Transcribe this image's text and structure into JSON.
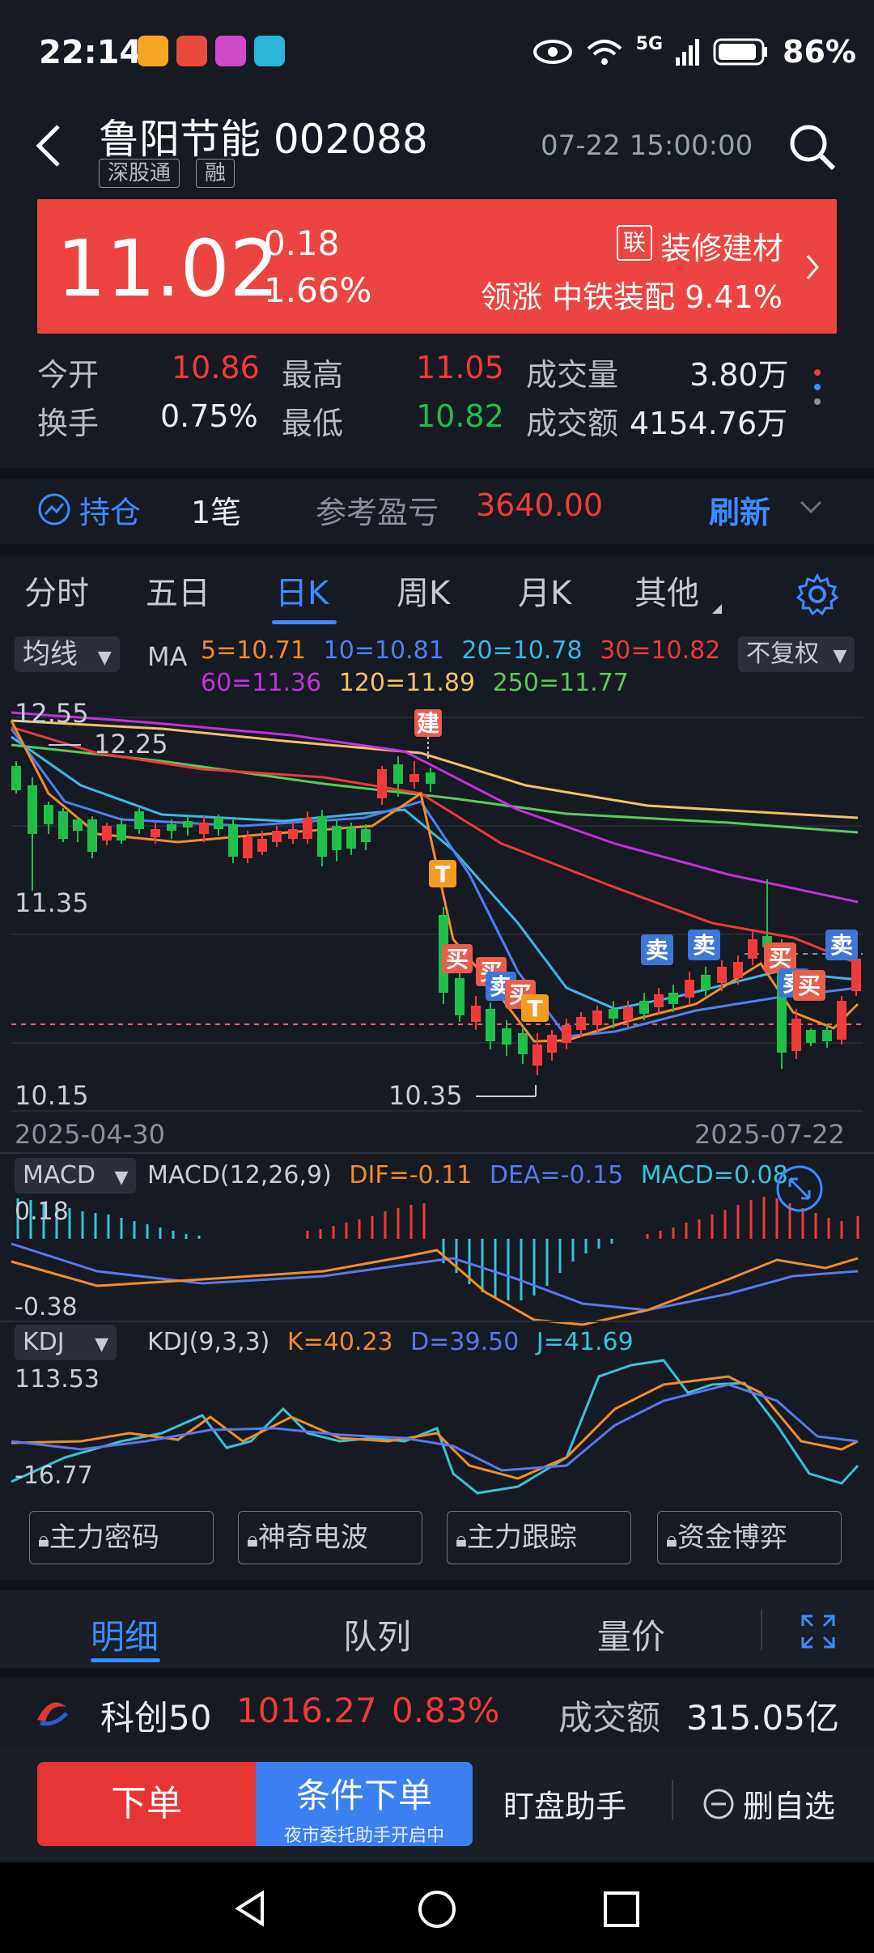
{
  "status": {
    "time": "22:14",
    "battery": "86%",
    "net": "5G"
  },
  "header": {
    "name": "鲁阳节能",
    "code": "002088",
    "tags": [
      "深股通",
      "融"
    ],
    "timestamp": "07-22 15:00:00"
  },
  "quote": {
    "price": "11.02",
    "change": "0.18",
    "pct": "1.66%",
    "sector_tag": "联",
    "sector": "装修建材",
    "leader": "领涨 中铁装配 9.41%"
  },
  "stats": {
    "open_label": "今开",
    "open": "10.86",
    "high_label": "最高",
    "high": "11.05",
    "vol_label": "成交量",
    "vol": "3.80万",
    "turn_label": "换手",
    "turn": "0.75%",
    "low_label": "最低",
    "low": "10.82",
    "amt_label": "成交额",
    "amt": "4154.76万"
  },
  "holding": {
    "label": "持仓",
    "count": "1笔",
    "pnl_label": "参考盈亏",
    "pnl": "3640.00",
    "refresh": "刷新"
  },
  "tabs": [
    "分时",
    "五日",
    "日K",
    "周K",
    "月K",
    "其他"
  ],
  "ma": {
    "select": "均线",
    "label": "MA",
    "ma5": "5=10.71",
    "ma10": "10=10.81",
    "ma20": "20=10.78",
    "ma30": "30=10.82",
    "ma60": "60=11.36",
    "ma120": "120=11.89",
    "ma250": "250=11.77",
    "adjust": "不复权"
  },
  "price_axis": {
    "top": "12.55",
    "mark": "12.25",
    "mid": "11.35",
    "bottom": "10.15",
    "low_mark": "10.35"
  },
  "dates": {
    "start": "2025-04-30",
    "end": "2025-07-22"
  },
  "signals": [
    "建",
    "T",
    "买",
    "买",
    "卖",
    "买",
    "T",
    "卖",
    "卖",
    "买",
    "卖",
    "买",
    "卖"
  ],
  "macd": {
    "select": "MACD",
    "label": "MACD(12,26,9)",
    "dif": "DIF=-0.11",
    "dea": "DEA=-0.15",
    "macd": "MACD=0.08",
    "top": "0.18",
    "bottom": "-0.38"
  },
  "kdj": {
    "select": "KDJ",
    "label": "KDJ(9,3,3)",
    "k": "K=40.23",
    "d": "D=39.50",
    "j": "J=41.69",
    "top": "113.53",
    "bottom": "-16.77"
  },
  "features": [
    "主力密码",
    "神奇电波",
    "主力跟踪",
    "资金博弈"
  ],
  "detail_tabs": [
    "明细",
    "队列",
    "量价"
  ],
  "index": {
    "name": "科创50",
    "value": "1016.27",
    "pct": "0.83%",
    "amt_label": "成交额",
    "amt": "315.05亿"
  },
  "actions": {
    "order": "下单",
    "cond": "条件下单",
    "cond_sub": "夜市委托助手开启中",
    "watch": "盯盘助手",
    "remove": "删自选"
  },
  "colors": {
    "up": "#f13a39",
    "down": "#1fbf4a",
    "accent": "#3d8bff",
    "panel": "#ec4441"
  }
}
